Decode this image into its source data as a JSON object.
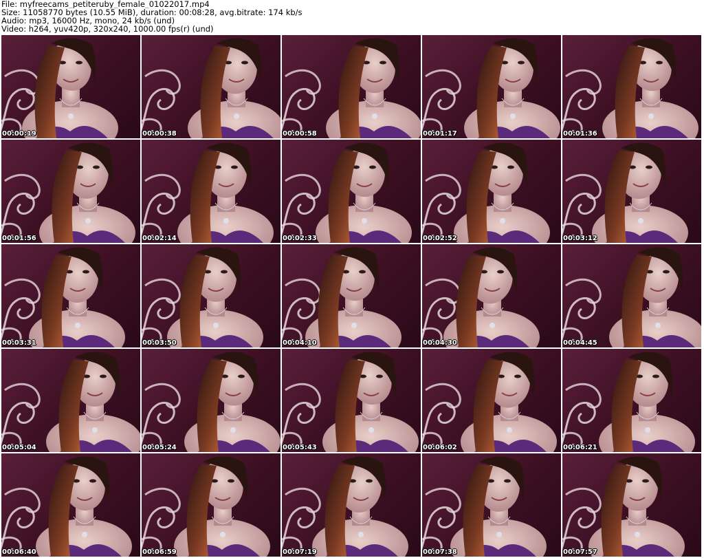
{
  "header": {
    "file_line": "File: myfreecams_petiteruby_female_01022017.mp4",
    "size_line": "Size: 11058770 bytes (10.55 MiB), duration: 00:08:28, avg.bitrate: 174 kb/s",
    "audio_line": "Audio: mp3, 16000 Hz, mono, 24 kb/s (und)",
    "video_line": "Video: h264, yuv420p, 320x240, 1000.00 fps(r) (und)"
  },
  "thumbnails": [
    {
      "timestamp": "00:00:19"
    },
    {
      "timestamp": "00:00:38"
    },
    {
      "timestamp": "00:00:58"
    },
    {
      "timestamp": "00:01:17"
    },
    {
      "timestamp": "00:01:36"
    },
    {
      "timestamp": "00:01:56"
    },
    {
      "timestamp": "00:02:14"
    },
    {
      "timestamp": "00:02:33"
    },
    {
      "timestamp": "00:02:52"
    },
    {
      "timestamp": "00:03:12"
    },
    {
      "timestamp": "00:03:31"
    },
    {
      "timestamp": "00:03:50"
    },
    {
      "timestamp": "00:04:10"
    },
    {
      "timestamp": "00:04:30"
    },
    {
      "timestamp": "00:04:45"
    },
    {
      "timestamp": "00:05:04"
    },
    {
      "timestamp": "00:05:24"
    },
    {
      "timestamp": "00:05:43"
    },
    {
      "timestamp": "00:06:02"
    },
    {
      "timestamp": "00:06:21"
    },
    {
      "timestamp": "00:06:40"
    },
    {
      "timestamp": "00:06:59"
    },
    {
      "timestamp": "00:07:19"
    },
    {
      "timestamp": "00:07:38"
    },
    {
      "timestamp": "00:07:57"
    }
  ]
}
